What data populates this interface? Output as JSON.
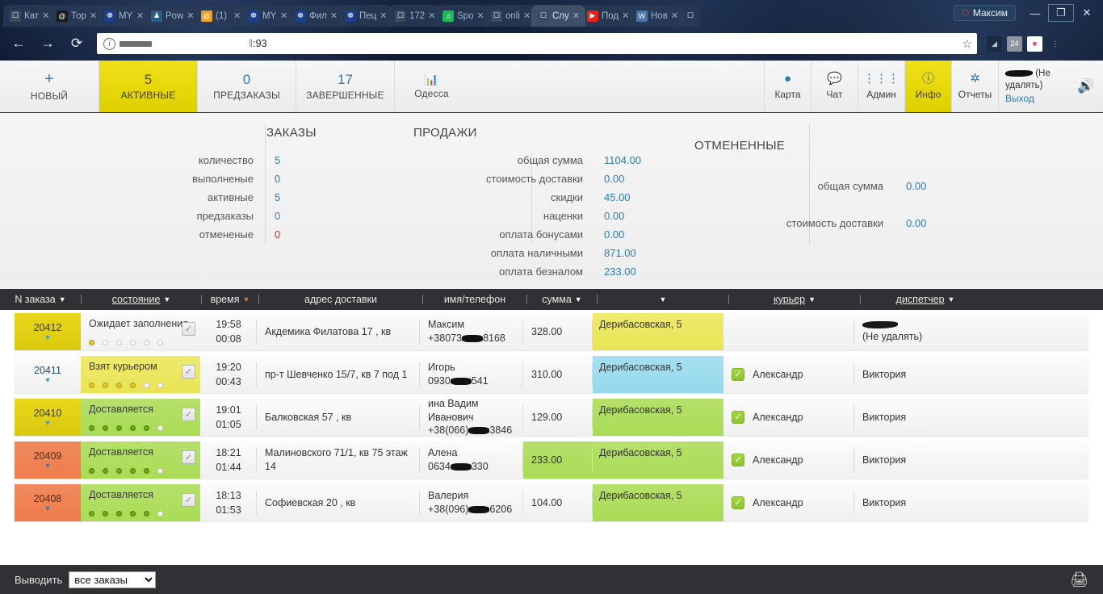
{
  "browser": {
    "tabs": [
      {
        "label": "Кат",
        "favicon": "page-icon",
        "color": "#3a4a5e",
        "glyph": "☐",
        "active": false
      },
      {
        "label": "Тор",
        "favicon": "onion-icon",
        "color": "#1a1a1a",
        "glyph": "@",
        "active": false
      },
      {
        "label": "MY",
        "favicon": "globe-icon",
        "color": "#1b3f8b",
        "glyph": "☸",
        "active": false
      },
      {
        "label": "Pow",
        "favicon": "figure-icon",
        "color": "#2c5d85",
        "glyph": "♟",
        "active": false
      },
      {
        "label": "(1) ",
        "favicon": "mail-icon",
        "color": "#f0a020",
        "glyph": "@",
        "active": false
      },
      {
        "label": "MY",
        "favicon": "globe-icon",
        "color": "#1b3f8b",
        "glyph": "☸",
        "active": false
      },
      {
        "label": "Фил",
        "favicon": "globe-icon",
        "color": "#1b3f8b",
        "glyph": "☸",
        "active": false
      },
      {
        "label": "Пец",
        "favicon": "globe-icon",
        "color": "#1b3f8b",
        "glyph": "☸",
        "active": false
      },
      {
        "label": "172",
        "favicon": "page-icon",
        "color": "#3a4a5e",
        "glyph": "☐",
        "active": false
      },
      {
        "label": "Spo",
        "favicon": "spotify-icon",
        "color": "#1db954",
        "glyph": "♫",
        "active": false
      },
      {
        "label": "onli",
        "favicon": "page-icon",
        "color": "#3a4a5e",
        "glyph": "☐",
        "active": false
      },
      {
        "label": "Слу",
        "favicon": "page-icon",
        "color": "#3a4a5e",
        "glyph": "☐",
        "active": true
      },
      {
        "label": "Под",
        "favicon": "youtube-icon",
        "color": "#e62117",
        "glyph": "▶",
        "active": false
      },
      {
        "label": "Нов",
        "favicon": "vk-icon",
        "color": "#4a76a8",
        "glyph": "W",
        "active": false
      }
    ],
    "tab_close_glyph": "✕",
    "account_name": "Максим",
    "account_icon": "power-icon",
    "window_buttons": {
      "minimize": "—",
      "restore": "❐",
      "close": "✕"
    },
    "nav": {
      "back_icon": "arrow-left-icon",
      "forward_icon": "arrow-right-icon",
      "reload_icon": "reload-icon",
      "site_info_icon": "info-icon",
      "url_visible": ":93",
      "url_redacted": true,
      "bookmark_icon": "star-icon",
      "extensions": [
        {
          "name": "share-icon",
          "glyph": "◥",
          "color": "#1f2d44"
        },
        {
          "name": "calendar-24-icon",
          "glyph": "24",
          "color": "#8a8f96"
        },
        {
          "name": "shopping-bag-icon",
          "glyph": "▮",
          "color": "#d94f7c"
        },
        {
          "name": "chrome-menu-icon",
          "glyph": "⋮",
          "color": "#1f2d44"
        }
      ]
    }
  },
  "topnav": {
    "left": [
      {
        "name": "new",
        "plus": "+",
        "count": null,
        "label": "НОВЫЙ",
        "active": false,
        "icon": null
      },
      {
        "name": "active",
        "plus": null,
        "count": "5",
        "label": "АКТИВНЫЕ",
        "active": true,
        "icon": null
      },
      {
        "name": "preorders",
        "plus": null,
        "count": "0",
        "label": "ПРЕДЗАКАЗЫ",
        "active": false,
        "icon": null
      },
      {
        "name": "completed",
        "plus": null,
        "count": "17",
        "label": "ЗАВЕРШЕННЫЕ",
        "active": false,
        "icon": null
      },
      {
        "name": "city",
        "plus": null,
        "count": null,
        "label": "Одесса",
        "active": false,
        "icon": "chart-icon"
      }
    ],
    "right": [
      {
        "name": "map",
        "label": "Карта",
        "icon": "📍",
        "active": false
      },
      {
        "name": "chat",
        "label": "Чат",
        "icon": "💬",
        "active": false
      },
      {
        "name": "admin",
        "label": "Админ",
        "icon": "≡",
        "active": false
      },
      {
        "name": "info",
        "label": "Инфо",
        "icon": "ℹ",
        "active": true
      },
      {
        "name": "reports",
        "label": "Отчеты",
        "icon": "⚙",
        "active": false
      }
    ],
    "user": {
      "name_redacted": true,
      "suffix": "(Не удалять)",
      "logout": "Выход"
    },
    "sound_icon": "speaker-icon"
  },
  "stats": {
    "orders": {
      "title": "ЗАКАЗЫ",
      "rows": [
        {
          "k": "количество",
          "v": "5",
          "red": false
        },
        {
          "k": "выполненые",
          "v": "0",
          "red": false
        },
        {
          "k": "активные",
          "v": "5",
          "red": false
        },
        {
          "k": "предзаказы",
          "v": "0",
          "red": false
        },
        {
          "k": "отмененые",
          "v": "0",
          "red": true
        }
      ]
    },
    "sales": {
      "title": "ПРОДАЖИ",
      "rows": [
        {
          "k": "общая сумма",
          "v": "1104.00"
        },
        {
          "k": "стоимость доставки",
          "v": "0.00"
        },
        {
          "k": "скидки",
          "v": "45.00"
        },
        {
          "k": "наценки",
          "v": "0.00"
        },
        {
          "k": "оплата бонусами",
          "v": "0.00"
        },
        {
          "k": "оплата наличными",
          "v": "871.00"
        },
        {
          "k": "оплата безналом",
          "v": "233.00"
        }
      ]
    },
    "cancelled": {
      "title": "ОТМЕНЕННЫЕ",
      "rows": [
        {
          "k": "общая сумма",
          "v": "0.00"
        },
        {
          "k": "стоимость доставки",
          "v": "0.00"
        }
      ]
    }
  },
  "table": {
    "columns": [
      {
        "name": "order-number",
        "label": "N заказа",
        "sort": "desc",
        "sort_color": "white",
        "underline": false
      },
      {
        "name": "state",
        "label": "состояние",
        "sort": "desc",
        "sort_color": "white",
        "underline": true
      },
      {
        "name": "time",
        "label": "время",
        "sort": "desc",
        "sort_color": "orange",
        "underline": false
      },
      {
        "name": "delivery-address",
        "label": "адрес доставки",
        "sort": null,
        "sort_color": null,
        "underline": false
      },
      {
        "name": "name-phone",
        "label": "имя/телефон",
        "sort": null,
        "sort_color": null,
        "underline": false
      },
      {
        "name": "sum",
        "label": "сумма",
        "sort": "desc",
        "sort_color": "white",
        "underline": false
      },
      {
        "name": "restaurant",
        "label": "",
        "sort": "desc",
        "sort_color": "white",
        "underline": false
      },
      {
        "name": "courier",
        "label": "курьер",
        "sort": "desc",
        "sort_color": "white",
        "underline": true
      },
      {
        "name": "dispatcher",
        "label": "диспетчер",
        "sort": "desc",
        "sort_color": "white",
        "underline": true
      }
    ],
    "rows": [
      {
        "number": "20412",
        "number_color": "y",
        "state": "Ожидает заполнения",
        "state_color": "plain",
        "state_dots": [
          "#e8c81e",
          "",
          "",
          "",
          "",
          ""
        ],
        "checked": true,
        "time_top": "19:58",
        "time_bottom": "00:08",
        "address": "Акдемика Филатова 17 , кв",
        "cust_name": "Максим",
        "cust_name_redacted": false,
        "cust_phone_pre": "+38073",
        "cust_phone_post": "8168",
        "sum": "328.00",
        "sum_hl": false,
        "restaurant": "Дерибасовская, 5",
        "rest_color": "yellow",
        "rest_dots": [
          "#e8c81e",
          "",
          ""
        ],
        "courier": "",
        "courier_check": false,
        "dispatcher": "(Не удалять)",
        "dispatcher_blob": true
      },
      {
        "number": "20411",
        "number_color": "w",
        "state": "Взят курьером",
        "state_color": "yellow",
        "state_dots": [
          "#e8c81e",
          "#e8c81e",
          "#e8c81e",
          "#e8c81e",
          "",
          ""
        ],
        "checked": true,
        "time_top": "19:20",
        "time_bottom": "00:43",
        "address": "пр-т Шевченко 15/7, кв 7 под 1",
        "cust_name": "Игорь",
        "cust_name_redacted": false,
        "cust_phone_pre": "0930",
        "cust_phone_post": "541",
        "sum": "310.00",
        "sum_hl": false,
        "restaurant": "Дерибасовская, 5",
        "rest_color": "blue",
        "rest_dots": [
          "#2f9fd0",
          "#2f9fd0",
          ""
        ],
        "courier": "Александр",
        "courier_check": true,
        "dispatcher": "Виктория",
        "dispatcher_blob": false
      },
      {
        "number": "20410",
        "number_color": "y",
        "state": "Доставляется",
        "state_color": "green",
        "state_dots": [
          "#6fa814",
          "#6fa814",
          "#6fa814",
          "#6fa814",
          "#6fa814",
          ""
        ],
        "checked": true,
        "time_top": "19:01",
        "time_bottom": "01:05",
        "address": "Балковская 57 , кв",
        "cust_name": "ина Вадим Иванович",
        "cust_name_redacted": true,
        "cust_phone_pre": "+38(066)",
        "cust_phone_post": "3846",
        "sum": "129.00",
        "sum_hl": false,
        "restaurant": "Дерибасовская, 5",
        "rest_color": "green",
        "rest_dots": [
          "#6fa814",
          "#6fa814",
          "#6fa814"
        ],
        "courier": "Александр",
        "courier_check": true,
        "dispatcher": "Виктория",
        "dispatcher_blob": false
      },
      {
        "number": "20409",
        "number_color": "o",
        "state": "Доставляется",
        "state_color": "green",
        "state_dots": [
          "#6fa814",
          "#6fa814",
          "#6fa814",
          "#6fa814",
          "#6fa814",
          ""
        ],
        "checked": true,
        "time_top": "18:21",
        "time_bottom": "01:44",
        "address": "Малиновского 71/1, кв 75 этаж 14",
        "cust_name": "Алена",
        "cust_name_redacted": false,
        "cust_phone_pre": "0634",
        "cust_phone_post": "330",
        "sum": "233.00",
        "sum_hl": true,
        "restaurant": "Дерибасовская, 5",
        "rest_color": "green",
        "rest_dots": [
          "#6fa814",
          "#6fa814",
          "#6fa814"
        ],
        "courier": "Александр",
        "courier_check": true,
        "dispatcher": "Виктория",
        "dispatcher_blob": false
      },
      {
        "number": "20408",
        "number_color": "o",
        "state": "Доставляется",
        "state_color": "green",
        "state_dots": [
          "#6fa814",
          "#6fa814",
          "#6fa814",
          "#6fa814",
          "#6fa814",
          ""
        ],
        "checked": true,
        "time_top": "18:13",
        "time_bottom": "01:53",
        "address": "Софиевская 20 , кв",
        "cust_name": "Валерия",
        "cust_name_redacted": false,
        "cust_phone_pre": "+38(096)",
        "cust_phone_post": "6206",
        "sum": "104.00",
        "sum_hl": false,
        "restaurant": "Дерибасовская, 5",
        "rest_color": "green",
        "rest_dots": [
          "#6fa814",
          "#6fa814",
          "#6fa814"
        ],
        "courier": "Александр",
        "courier_check": true,
        "dispatcher": "Виктория",
        "dispatcher_blob": false
      }
    ]
  },
  "footer": {
    "label": "Выводить",
    "filter_value": "все заказы",
    "filter_options": [
      "все заказы"
    ],
    "print_icon": "printer-icon"
  },
  "colors": {
    "accent_yellow": "#e8d71b",
    "accent_green": "#a9dc55",
    "accent_blue": "#2b7bb9",
    "accent_orange": "#ef7b4b",
    "dark_bar": "#303134"
  }
}
